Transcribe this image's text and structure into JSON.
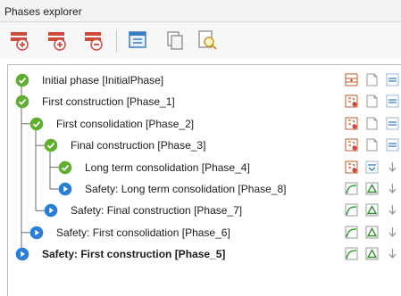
{
  "panel": {
    "title": "Phases explorer"
  },
  "toolbar": {
    "buttons": [
      {
        "name": "insert-phase-button",
        "icon": "insert-phase-icon"
      },
      {
        "name": "add-phase-button",
        "icon": "add-phase-icon"
      },
      {
        "name": "delete-phase-button",
        "icon": "delete-phase-icon"
      },
      {
        "name": "edit-phase-button",
        "icon": "phase-settings-icon"
      },
      {
        "name": "copy-phase-button",
        "icon": "copy-icon"
      },
      {
        "name": "preview-phase-button",
        "icon": "preview-icon"
      }
    ]
  },
  "phases": [
    {
      "label": "Initial phase [InitialPhase]",
      "status": "done",
      "level": 0,
      "bold": false,
      "actions": [
        "initial-stress-icon",
        "page-icon",
        "flow-icon"
      ]
    },
    {
      "label": "First construction [Phase_1]",
      "status": "done",
      "level": 0,
      "bold": false,
      "actions": [
        "plastic-analysis-icon",
        "page-icon",
        "flow-icon"
      ]
    },
    {
      "label": "First consolidation [Phase_2]",
      "status": "done",
      "level": 1,
      "bold": false,
      "actions": [
        "plastic-analysis-icon",
        "page-icon",
        "flow-icon"
      ]
    },
    {
      "label": "Final construction [Phase_3]",
      "status": "done",
      "level": 2,
      "bold": false,
      "actions": [
        "plastic-analysis-icon",
        "page-icon",
        "flow-icon"
      ]
    },
    {
      "label": "Long term consolidation [Phase_4]",
      "status": "done",
      "level": 3,
      "bold": false,
      "actions": [
        "plastic-analysis-icon",
        "consolidation-icon",
        "arrow-down-icon"
      ]
    },
    {
      "label": "Safety: Long term consolidation [Phase_8]",
      "status": "pending",
      "level": 3,
      "bold": false,
      "actions": [
        "safety-curve-icon",
        "incremental-delta-icon",
        "arrow-down-icon"
      ]
    },
    {
      "label": "Safety: Final construction [Phase_7]",
      "status": "pending",
      "level": 2,
      "bold": false,
      "actions": [
        "safety-curve-icon",
        "incremental-delta-icon",
        "arrow-down-icon"
      ]
    },
    {
      "label": "Safety: First consolidation [Phase_6]",
      "status": "pending",
      "level": 1,
      "bold": false,
      "actions": [
        "safety-curve-icon",
        "incremental-delta-icon",
        "arrow-down-icon"
      ]
    },
    {
      "label": "Safety: First construction [Phase_5]",
      "status": "pending",
      "level": 0,
      "bold": true,
      "actions": [
        "safety-curve-icon",
        "incremental-delta-icon",
        "arrow-down-icon"
      ]
    }
  ],
  "colors": {
    "done": "#5fae2e",
    "pending": "#2a7fd4"
  }
}
